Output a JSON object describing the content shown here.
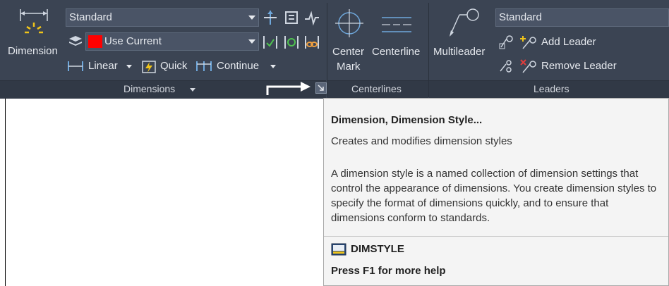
{
  "ribbon": {
    "dimension_button": "Dimension",
    "dim_style_combo": "Standard",
    "layer_combo": "Use Current",
    "layer_color": "#ff0000",
    "linear_label": "Linear",
    "quick_label": "Quick",
    "continue_label": "Continue",
    "dimensions_panel_title": "Dimensions",
    "center_mark_label_1": "Center",
    "center_mark_label_2": "Mark",
    "centerline_label": "Centerline",
    "centerlines_panel_title": "Centerlines",
    "multileader_label": "Multileader",
    "mleader_style_combo": "Standard",
    "add_leader_label": "Add Leader",
    "remove_leader_label": "Remove Leader",
    "leaders_panel_title": "Leaders"
  },
  "tooltip": {
    "title": "Dimension, Dimension Style...",
    "short_desc": "Creates and modifies dimension styles",
    "long_desc": "A dimension style is a named collection of dimension settings that control the appearance of dimensions. You create dimension styles to specify the format of dimensions quickly, and to ensure that dimensions conform to standards.",
    "command": "DIMSTYLE",
    "help": "Press F1 for more help"
  },
  "colors": {
    "ribbon_bg": "#3b4453",
    "accent_icon": "#f0c419",
    "remove_red": "#e03c3c"
  }
}
